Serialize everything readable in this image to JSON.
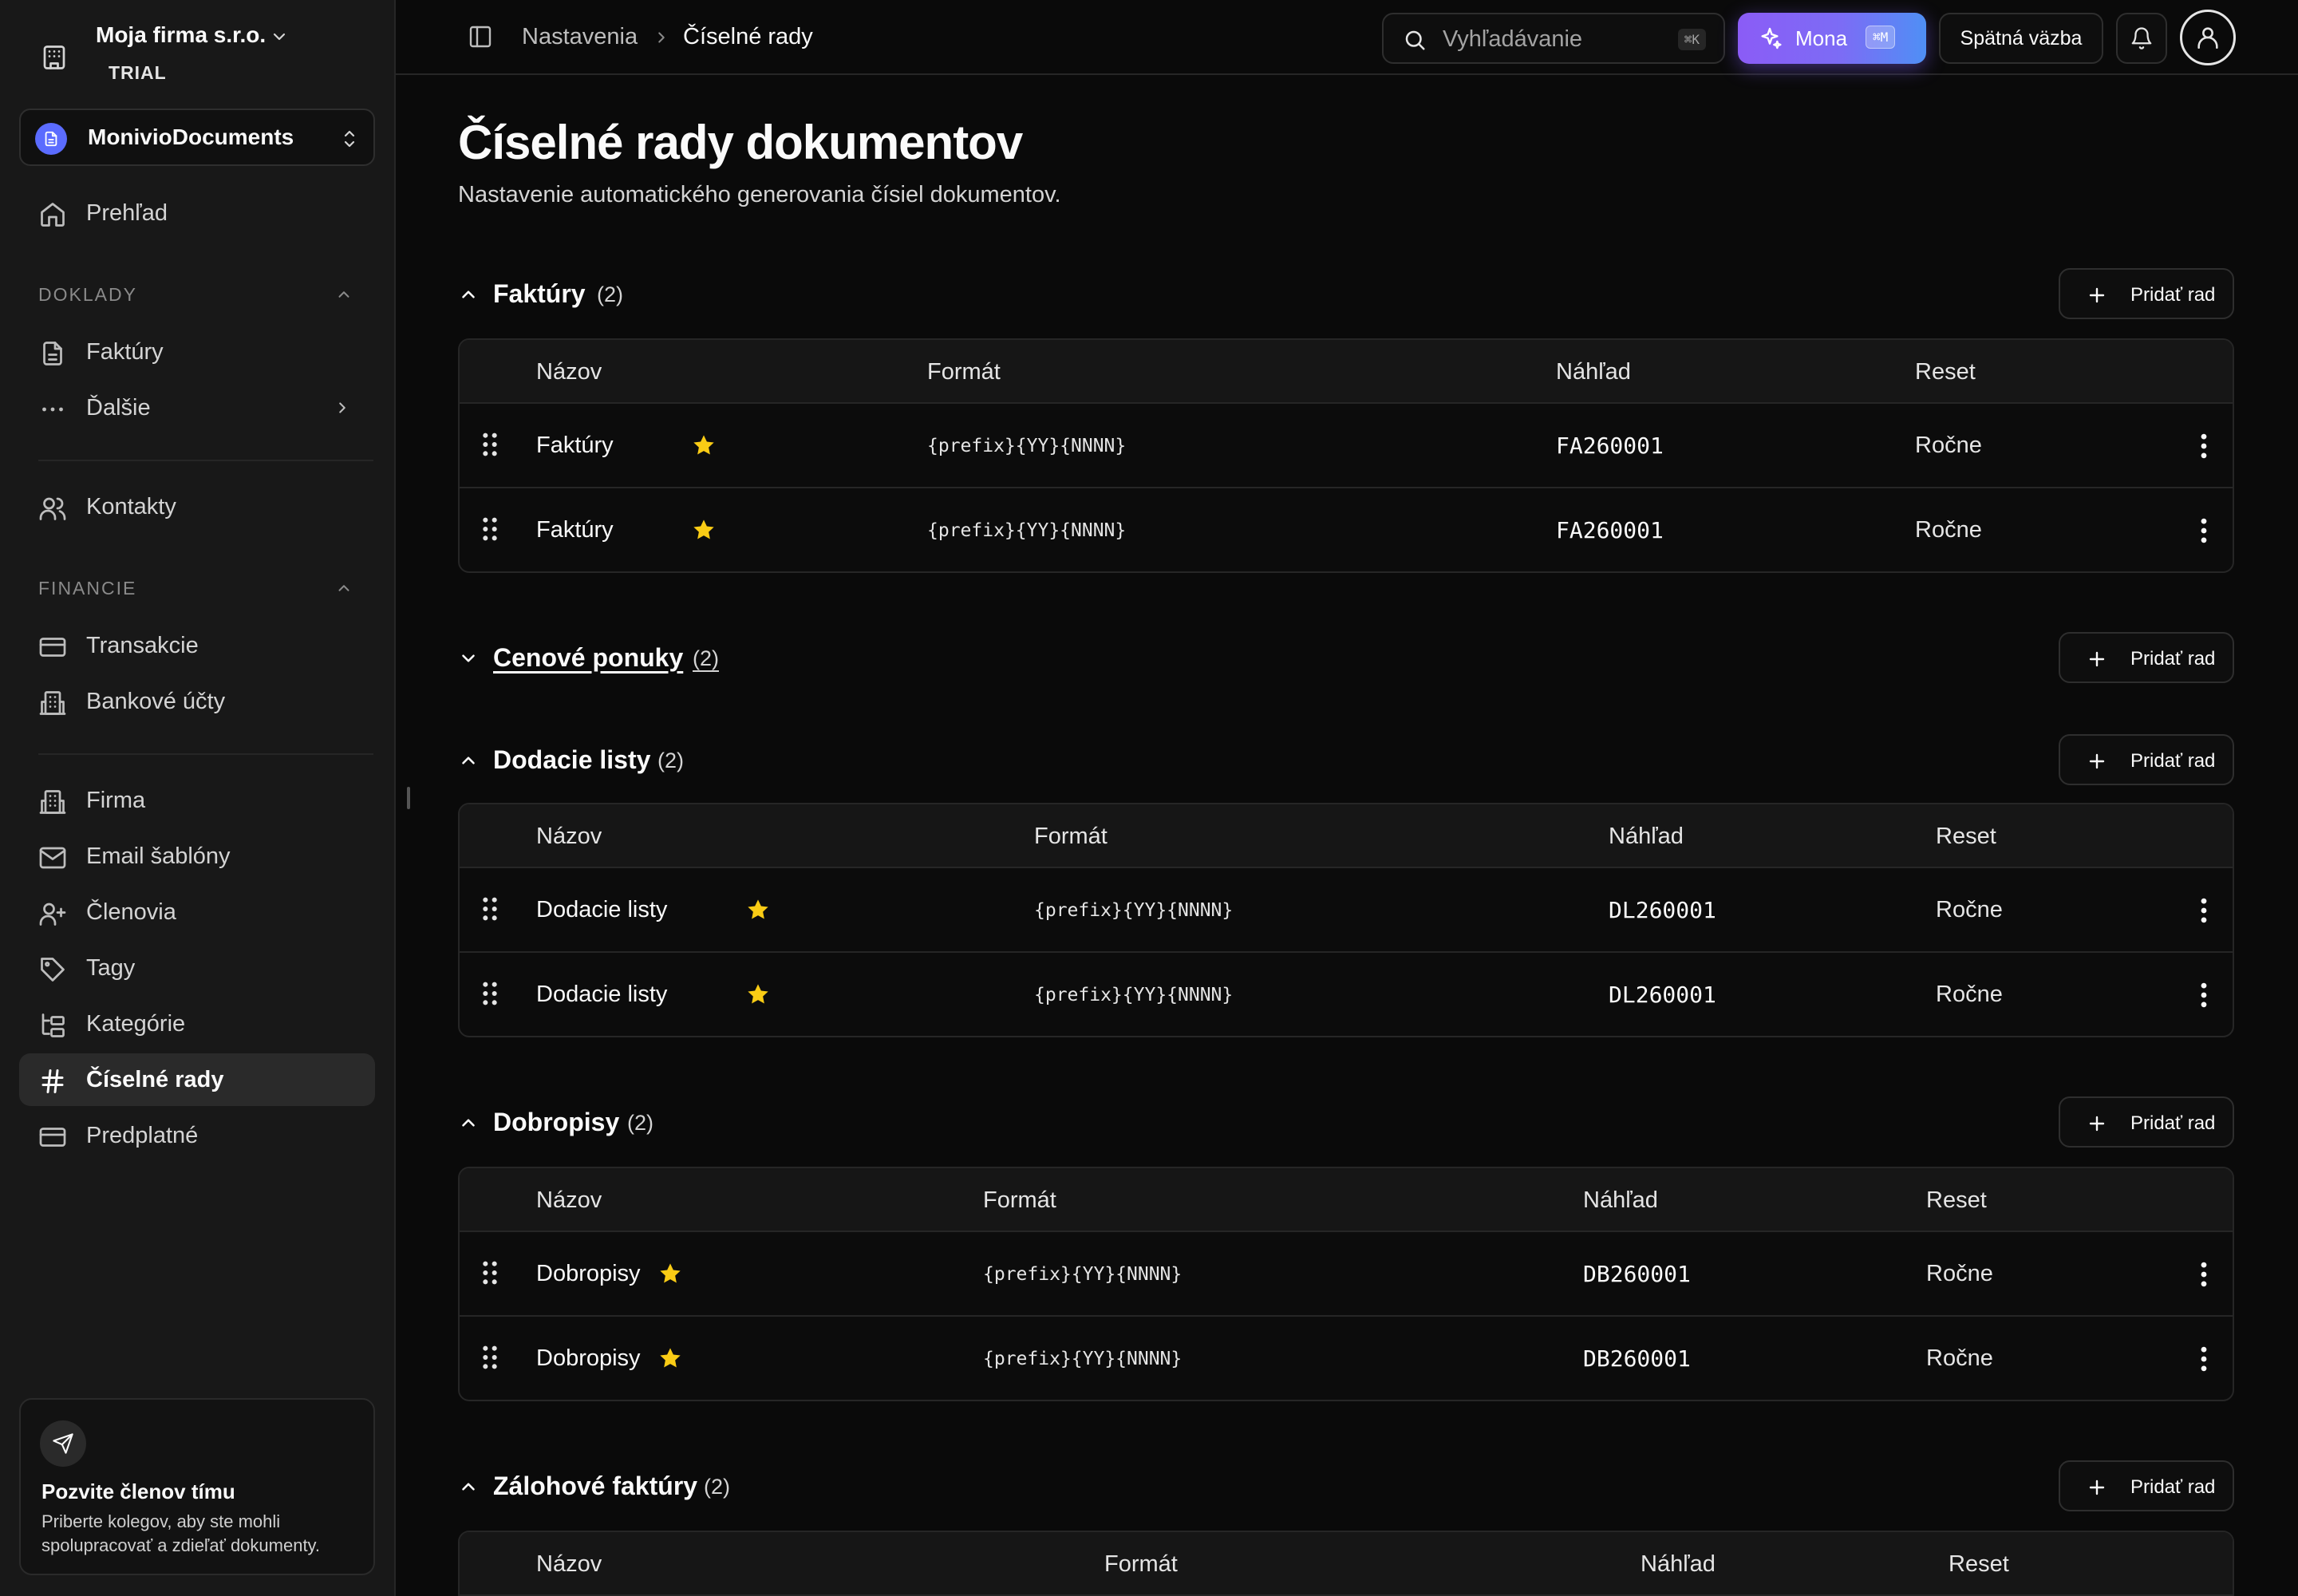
{
  "sidebar": {
    "org_name": "Moja firma s.r.o.",
    "org_plan": "TRIAL",
    "workspace": "MonivioDocuments",
    "overview": "Prehľad",
    "sections": {
      "doklady": "DOKLADY",
      "financie": "FINANCIE"
    },
    "items": {
      "faktury": "Faktúry",
      "dalsie": "Ďalšie",
      "kontakty": "Kontakty",
      "transakcie": "Transakcie",
      "bankove_ucty": "Bankové účty",
      "firma": "Firma",
      "email_sablony": "Email šablóny",
      "clenovia": "Členovia",
      "tagy": "Tagy",
      "kategorie": "Kategórie",
      "ciselne_rady": "Číselné rady",
      "predplatne": "Predplatné"
    },
    "active_item": "ciselne_rady",
    "invite": {
      "title": "Pozvite členov tímu",
      "text": "Priberte kolegov, aby ste mohli spolupracovať a zdieľať dokumenty."
    }
  },
  "topbar": {
    "breadcrumb": [
      "Nastavenia",
      "Číselné rady"
    ],
    "search_placeholder": "Vyhľadávanie",
    "search_shortcut": "⌘K",
    "mona_label": "Mona",
    "mona_shortcut": "⌘M",
    "feedback_label": "Spätná väzba"
  },
  "page": {
    "title": "Číselné rady dokumentov",
    "subtitle": "Nastavenie automatického generovania čísiel dokumentov."
  },
  "columns": {
    "name": "Názov",
    "format": "Formát",
    "preview": "Náhľad",
    "reset": "Reset"
  },
  "add_label": "Pridať rad",
  "sections": [
    {
      "title": "Faktúry",
      "count": "(2)",
      "expanded": true,
      "rows": [
        {
          "name": "Faktúry",
          "format": "{prefix}{YY}{NNNN}",
          "preview": "FA260001",
          "reset": "Ročne"
        },
        {
          "name": "Faktúry",
          "format": "{prefix}{YY}{NNNN}",
          "preview": "FA260001",
          "reset": "Ročne"
        }
      ]
    },
    {
      "title": "Cenové ponuky",
      "count": "(2)",
      "expanded": false,
      "rows": []
    },
    {
      "title": "Dodacie listy",
      "count": "(2)",
      "expanded": true,
      "rows": [
        {
          "name": "Dodacie listy",
          "format": "{prefix}{YY}{NNNN}",
          "preview": "DL260001",
          "reset": "Ročne"
        },
        {
          "name": "Dodacie listy",
          "format": "{prefix}{YY}{NNNN}",
          "preview": "DL260001",
          "reset": "Ročne"
        }
      ]
    },
    {
      "title": "Dobropisy",
      "count": "(2)",
      "expanded": true,
      "rows": [
        {
          "name": "Dobropisy",
          "format": "{prefix}{YY}{NNNN}",
          "preview": "DB260001",
          "reset": "Ročne"
        },
        {
          "name": "Dobropisy",
          "format": "{prefix}{YY}{NNNN}",
          "preview": "DB260001",
          "reset": "Ročne"
        }
      ]
    },
    {
      "title": "Zálohové faktúry",
      "count": "(2)",
      "expanded": true,
      "rows": []
    }
  ],
  "colors": {
    "background": "#0a0a0a",
    "sidebar": "#181818",
    "star": "#facc15",
    "mona_gradient_start": "#8b5cf6",
    "mona_gradient_end": "#4f8ff5",
    "workspace_logo": "#5b6cff"
  }
}
